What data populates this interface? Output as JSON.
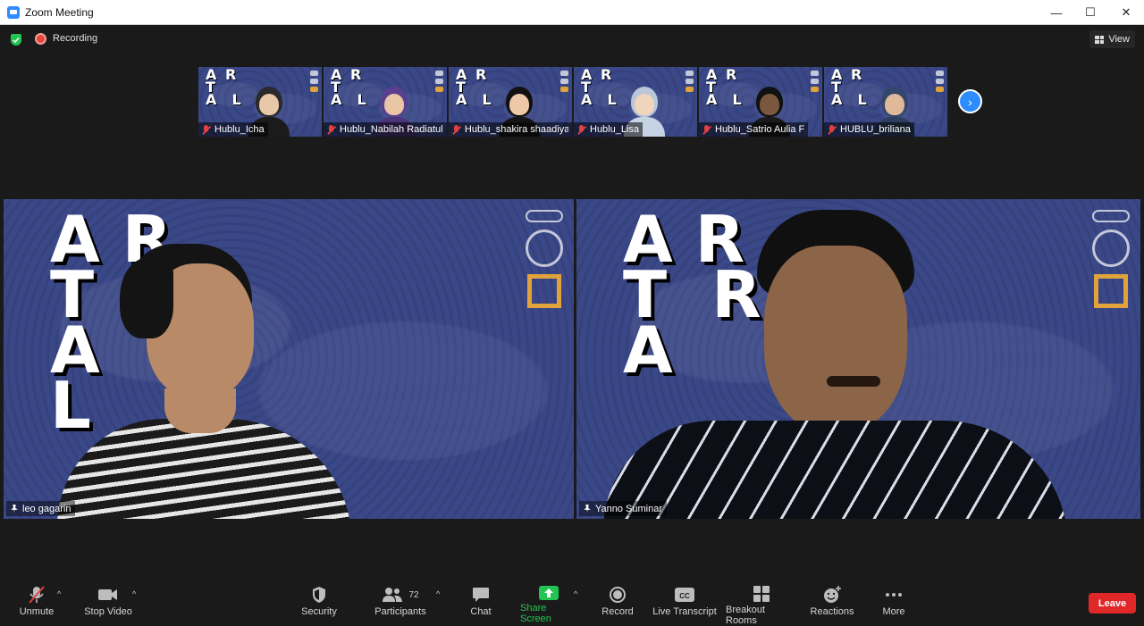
{
  "window": {
    "title": "Zoom Meeting",
    "minimize": "—",
    "maximize": "☐",
    "close": "✕"
  },
  "status": {
    "recording_label": "Recording",
    "view_label": "View"
  },
  "thumbnails": [
    {
      "name": "Hublu_Icha",
      "skin": "#e8c8a8",
      "hair": "#2a2a2a",
      "body": "#1b1b1b"
    },
    {
      "name": "Hublu_Nabilah Radiatul",
      "skin": "#e9c6a6",
      "hair": "#5a3f8f",
      "body": "#4b357a"
    },
    {
      "name": "Hublu_shakira shaadiya",
      "skin": "#edc8a9",
      "hair": "#111111",
      "body": "#141414"
    },
    {
      "name": "Hublu_Lisa",
      "skin": "#f0d4bc",
      "hair": "#b9c7d9",
      "body": "#c6d3e4"
    },
    {
      "name": "Hublu_Satrio Aulia F",
      "skin": "#7a5840",
      "hair": "#111111",
      "body": "#1a1a1a"
    },
    {
      "name": "HUBLU_briliana",
      "skin": "#e0b89a",
      "hair": "#33466b",
      "body": "#2d3e60"
    }
  ],
  "thumb_letters": "AR\nT\nAL",
  "videos": [
    {
      "name": "leo gagarin",
      "letters": "AR\nT\nAL"
    },
    {
      "name": "Yanno Suminar",
      "letters": "AR\nT RC\nA  H"
    }
  ],
  "toolbar": {
    "unmute": "Unmute",
    "stop_video": "Stop Video",
    "security": "Security",
    "participants": "Participants",
    "participants_count": "72",
    "chat": "Chat",
    "share_screen": "Share Screen",
    "record": "Record",
    "live_transcript": "Live Transcript",
    "breakout_rooms": "Breakout Rooms",
    "reactions": "Reactions",
    "more": "More",
    "leave": "Leave"
  },
  "colors": {
    "accent": "#2d8cff",
    "share_green": "#23c552",
    "leave_red": "#e02828",
    "active_speaker": "#e6eb8c"
  }
}
